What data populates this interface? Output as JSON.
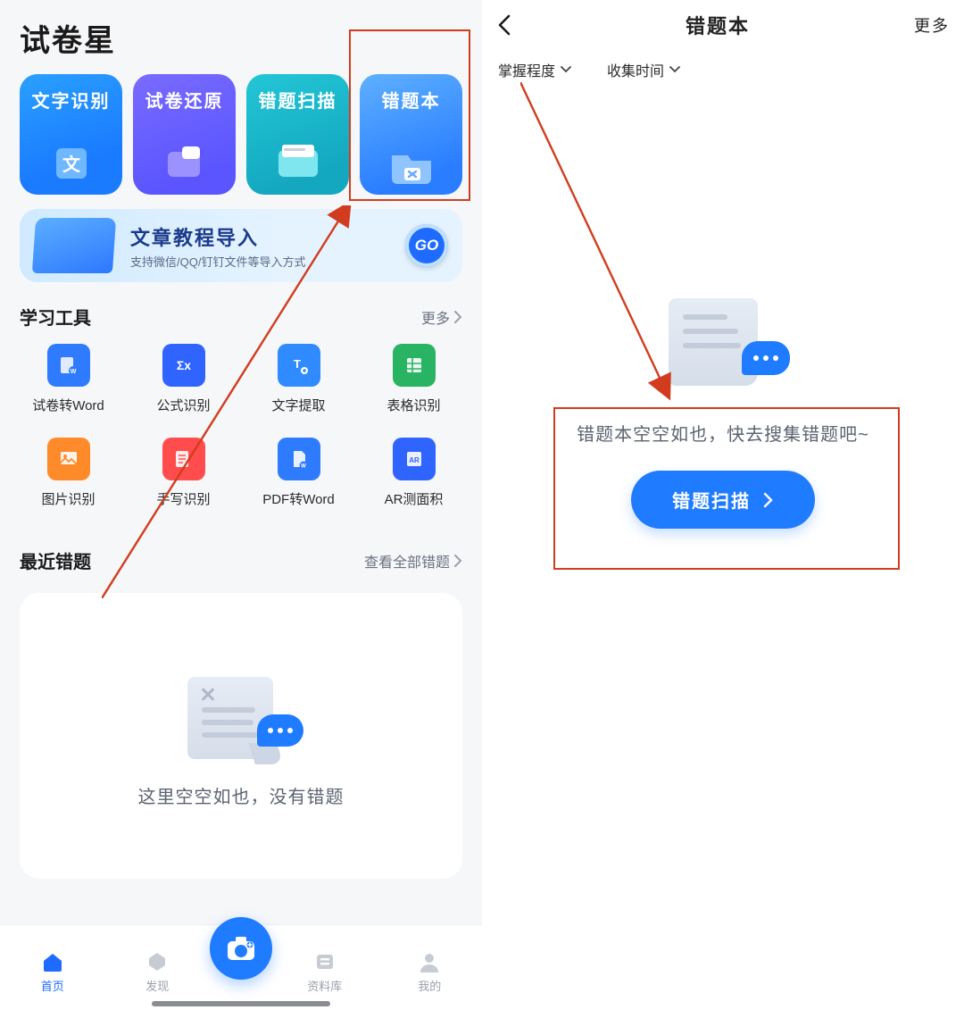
{
  "left": {
    "app_title": "试卷星",
    "features": [
      {
        "label": "文字识别",
        "icon": "text-recognition-icon"
      },
      {
        "label": "试卷还原",
        "icon": "paper-restore-icon"
      },
      {
        "label": "错题扫描",
        "icon": "wrong-scan-icon"
      },
      {
        "label": "错题本",
        "icon": "wrong-book-icon"
      }
    ],
    "import_banner": {
      "title": "文章教程导入",
      "subtitle": "支持微信/QQ/钉钉文件等导入方式",
      "go_label": "GO"
    },
    "tools_section": {
      "title": "学习工具",
      "more": "更多"
    },
    "tools": [
      {
        "label": "试卷转Word",
        "color": "#2f7bff"
      },
      {
        "label": "公式识别",
        "color": "#2f64ff"
      },
      {
        "label": "文字提取",
        "color": "#2f8bff"
      },
      {
        "label": "表格识别",
        "color": "#29b463"
      },
      {
        "label": "图片识别",
        "color": "#ff8a2a"
      },
      {
        "label": "手写识别",
        "color": "#ff4d4d"
      },
      {
        "label": "PDF转Word",
        "color": "#2f7bff"
      },
      {
        "label": "AR测面积",
        "color": "#2f64ff"
      }
    ],
    "recent_section": {
      "title": "最近错题",
      "more": "查看全部错题"
    },
    "recent_empty_text": "这里空空如也，没有错题",
    "tabs": [
      {
        "label": "首页",
        "icon": "home-icon",
        "active": true
      },
      {
        "label": "发现",
        "icon": "discover-icon",
        "active": false
      },
      {
        "label": "",
        "icon": "camera-icon",
        "active": false
      },
      {
        "label": "资料库",
        "icon": "library-icon",
        "active": false
      },
      {
        "label": "我的",
        "icon": "profile-icon",
        "active": false
      }
    ]
  },
  "right": {
    "header": {
      "title": "错题本",
      "more": "更多"
    },
    "filters": [
      {
        "label": "掌握程度"
      },
      {
        "label": "收集时间"
      }
    ],
    "empty_text": "错题本空空如也，快去搜集错题吧~",
    "scan_button": "错题扫描"
  }
}
